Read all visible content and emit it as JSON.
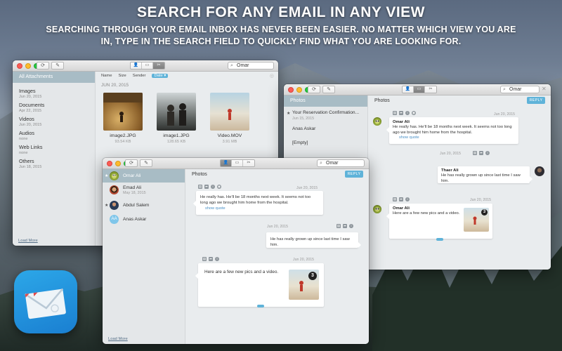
{
  "banner": {
    "headline": "SEARCH FOR ANY EMAIL IN ANY VIEW",
    "subline": "SEARCHING THROUGH YOUR EMAIL INBOX HAS NEVER BEEN EASIER. NO MATTER WHICH VIEW YOU ARE IN, TYPE IN THE SEARCH FIELD TO QUICKLY FIND WHAT YOU ARE LOOKING FOR."
  },
  "colors": {
    "accent": "#5fb3d9",
    "sidebar_selected": "#a8bcc5",
    "link": "#4a90c6"
  },
  "attachments_window": {
    "search_value": "Omar",
    "sort_options": [
      "Name",
      "Size",
      "Sender",
      "Date"
    ],
    "sort_selected": "Date",
    "sidebar_header": "All Attachments",
    "sidebar_items": [
      {
        "title": "Images",
        "sub": "Jun 20, 2015"
      },
      {
        "title": "Documents",
        "sub": "Apr 22, 2015"
      },
      {
        "title": "Videos",
        "sub": "Jun 20, 2015"
      },
      {
        "title": "Audios",
        "sub": "none"
      },
      {
        "title": "Web Links",
        "sub": "none"
      },
      {
        "title": "Others",
        "sub": "Jun 18, 2015"
      }
    ],
    "load_more": "Load More",
    "date_group": "JUN 20, 2015",
    "files": [
      {
        "name": "image2.JPG",
        "size": "93.54 KB"
      },
      {
        "name": "image1.JPG",
        "size": "128.65 KB"
      },
      {
        "name": "Video.MOV",
        "size": "3.91 MB"
      }
    ]
  },
  "thread_window": {
    "search_value": "Omar",
    "list": [
      {
        "title": "Photos",
        "starred": false
      },
      {
        "title": "Your Reservation Confirmation...",
        "sub": "Jun 15, 2015",
        "starred": true
      },
      {
        "title": "Anas Askar",
        "starred": false
      },
      {
        "title": "[Empty]",
        "starred": false
      }
    ],
    "pane_title": "Photos",
    "reply_label": "REPLY",
    "messages": [
      {
        "date": "Jun 20, 2015",
        "name": "Omar Ali",
        "text": "He really has. He'll be 18 months next week. It seems not too long ago we brought him home from the hospital.",
        "link": "show quote"
      },
      {
        "date": "Jun 20, 2015",
        "name": "Thaer Ali",
        "text": "He has really grown up since last time I saw him."
      },
      {
        "date": "Jun 20, 2015",
        "name": "Omar Ali",
        "text": "Here are a few new pics and a video.",
        "thumb_count": "3"
      }
    ]
  },
  "front_window": {
    "search_value": "Omar",
    "contacts": [
      {
        "name": "Omar Ali",
        "starred": true
      },
      {
        "name": "Emad Ali",
        "sub": "May 18, 2015",
        "starred": false
      },
      {
        "name": "Abdul Salem",
        "starred": true
      },
      {
        "name": "Anas Askar",
        "initials": "AA",
        "starred": false
      }
    ],
    "load_more": "Load More",
    "pane_title": "Photos",
    "reply_label": "REPLY",
    "messages": [
      {
        "date": "Jun 20, 2015",
        "text": "He really has. He'll be 18 months next week. It seems not too long ago we brought him home from the hospital.",
        "link": "show quote"
      },
      {
        "date": "Jun 20, 2015",
        "text": "He has really grown up since last time I saw him."
      },
      {
        "date": "Jun 20, 2015",
        "text": "Here are a few new pics and a video.",
        "thumb_count": "3"
      }
    ]
  }
}
